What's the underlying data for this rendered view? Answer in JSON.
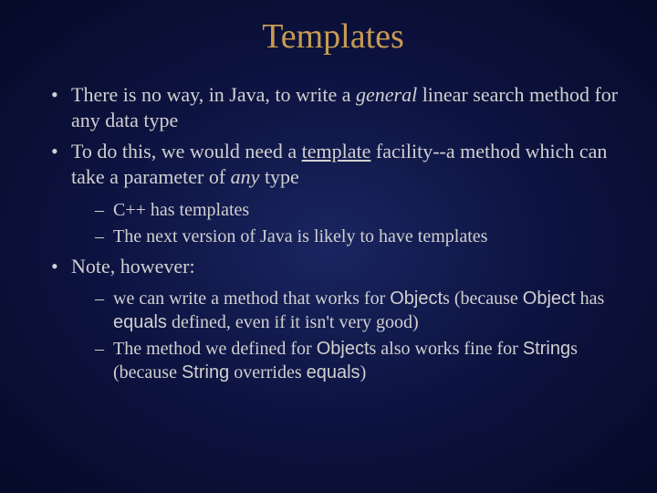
{
  "title": "Templates",
  "bullets": {
    "b1_pre": "There is no way, in Java, to write a ",
    "b1_em": "general",
    "b1_post": " linear search method for any data type",
    "b2_pre": "To do this, we would need a ",
    "b2_u": "template",
    "b2_mid": " facility--a method which can take a parameter of ",
    "b2_em": "any",
    "b2_post": " type",
    "b2_s1": "C++ has templates",
    "b2_s2": "The next version of Java is likely to have templates",
    "b3": "Note, however:",
    "b3_s1_a": "we can write a method that works for ",
    "b3_s1_b": "Object",
    "b3_s1_c": "s (because ",
    "b3_s1_d": "Object",
    "b3_s1_e": " has ",
    "b3_s1_f": "equals",
    "b3_s1_g": " defined, even if it isn't very good)",
    "b3_s2_a": "The method we defined for ",
    "b3_s2_b": "Object",
    "b3_s2_c": "s also works fine for ",
    "b3_s2_d": "String",
    "b3_s2_e": "s (because ",
    "b3_s2_f": "String",
    "b3_s2_g": " overrides ",
    "b3_s2_h": "equals",
    "b3_s2_i": ")"
  }
}
